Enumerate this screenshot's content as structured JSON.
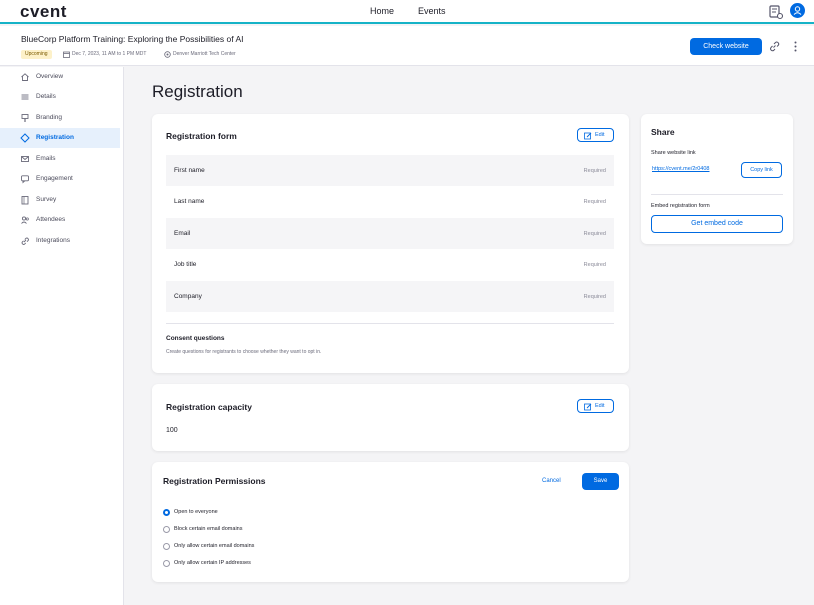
{
  "header": {
    "logo": "cvent",
    "nav": [
      "Home",
      "Events"
    ],
    "icons": [
      "settings-list-icon",
      "user-avatar-icon"
    ]
  },
  "event": {
    "title": "BlueCorp Platform Training: Exploring the Possibilities of AI",
    "status": "Upcoming",
    "date": "Dec 7, 2023, 11 AM to 1 PM MDT",
    "location": "Denver Marriott Tech Center",
    "check_website": "Check website"
  },
  "sidebar": {
    "items": [
      {
        "label": "Overview",
        "icon": "home-icon"
      },
      {
        "label": "Details",
        "icon": "list-icon"
      },
      {
        "label": "Branding",
        "icon": "brush-icon"
      },
      {
        "label": "Registration",
        "icon": "diamond-icon",
        "active": true
      },
      {
        "label": "Emails",
        "icon": "mail-icon"
      },
      {
        "label": "Engagement",
        "icon": "chat-icon"
      },
      {
        "label": "Survey",
        "icon": "clipboard-icon"
      },
      {
        "label": "Attendees",
        "icon": "people-icon"
      },
      {
        "label": "Integrations",
        "icon": "link-icon"
      }
    ]
  },
  "main": {
    "title": "Registration",
    "registration_form": {
      "title": "Registration form",
      "edit": "Edit",
      "fields": [
        {
          "name": "First name",
          "status": "Required"
        },
        {
          "name": "Last name",
          "status": "Required"
        },
        {
          "name": "Email",
          "status": "Required"
        },
        {
          "name": "Job title",
          "status": "Required"
        },
        {
          "name": "Company",
          "status": "Required"
        }
      ],
      "consent_title": "Consent questions",
      "consent_desc": "Create questions for registrants to choose whether they want to opt in."
    },
    "capacity": {
      "title": "Registration capacity",
      "edit": "Edit",
      "value": "100"
    },
    "permissions": {
      "title": "Registration Permissions",
      "cancel": "Cancel",
      "save": "Save",
      "options": [
        {
          "label": "Open to everyone",
          "checked": true
        },
        {
          "label": "Block certain email domains",
          "checked": false
        },
        {
          "label": "Only allow certain email domains",
          "checked": false
        },
        {
          "label": "Only allow certain IP addresses",
          "checked": false
        }
      ]
    }
  },
  "share": {
    "title": "Share",
    "link_label": "Share website link",
    "link": "https://cvent.me/2r0408",
    "copy": "Copy link",
    "embed_label": "Embed registration form",
    "embed_button": "Get embed code"
  },
  "colors": {
    "accent": "#006ae1",
    "teal_rule": "#16b3c7",
    "upcoming_badge": "#fdf1c9"
  }
}
